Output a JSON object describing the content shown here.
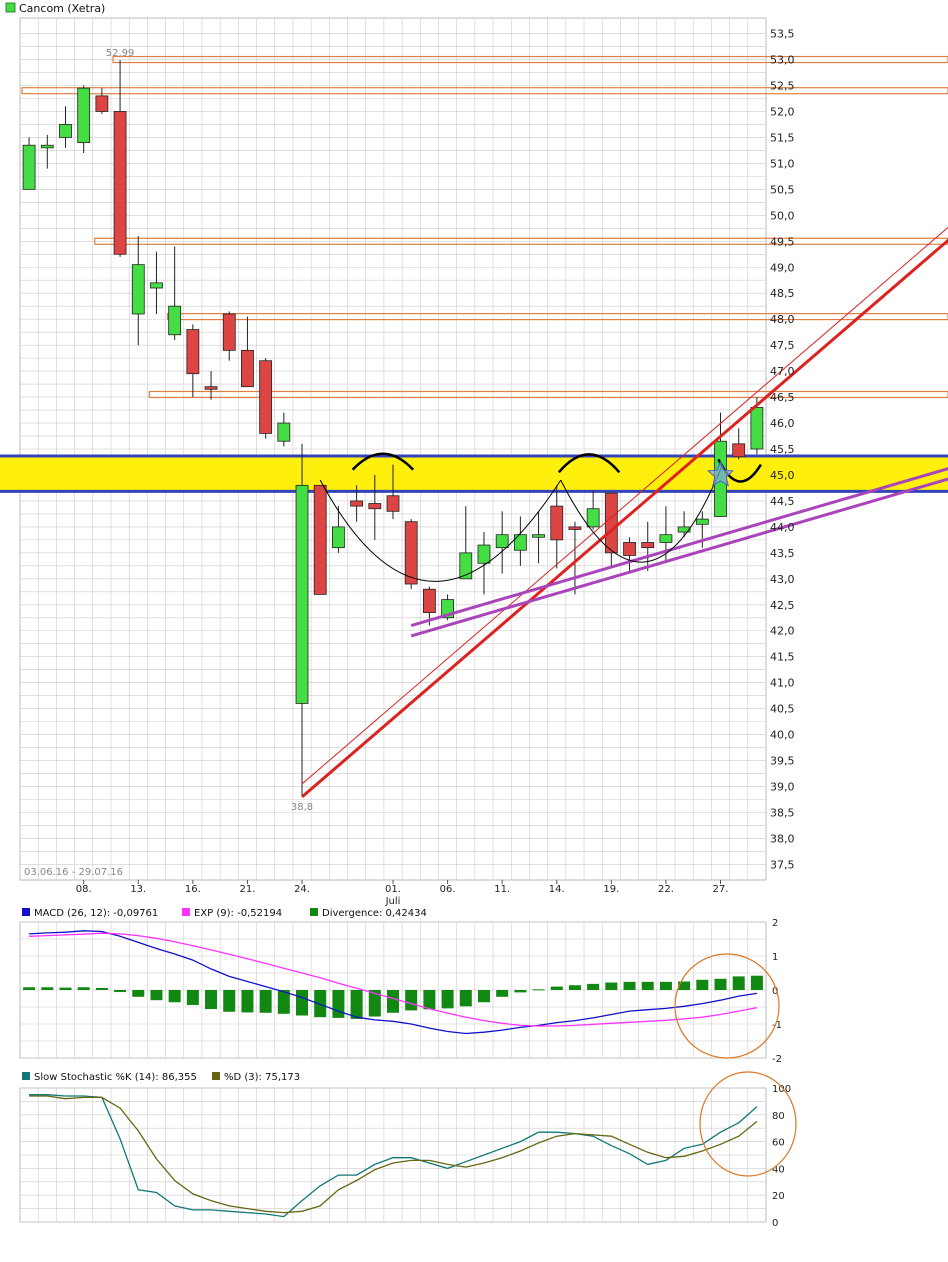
{
  "title": "Cancom (Xetra)",
  "date_range": "03.06.16 - 29.07.16",
  "colors": {
    "up": "#44dd44",
    "down": "#dd4444",
    "grid": "#cccccc",
    "support_band": "#ffee00",
    "support_band_border": "#3344bb",
    "resistance": "#e08040",
    "trend_red": "#dd2222",
    "trend_purple": "#aa44bb",
    "pattern": "#000000",
    "macd": "#1111cc",
    "exp": "#ff33ff",
    "divergence": "#118811",
    "stoch_k": "#117777",
    "stoch_d": "#666611",
    "highlight_circle": "#dd7722"
  },
  "chart_data": [
    {
      "type": "candlestick",
      "title": "Cancom (Xetra)",
      "ylim": [
        37.2,
        53.8
      ],
      "y_ticks": [
        "53,5",
        "53,0",
        "52,5",
        "52,0",
        "51,5",
        "51,0",
        "50,5",
        "50,0",
        "49,5",
        "49,0",
        "48,5",
        "48,0",
        "47,5",
        "47,0",
        "46,5",
        "46,0",
        "45,5",
        "45,0",
        "44,5",
        "44,0",
        "43,5",
        "43,0",
        "42,5",
        "42,0",
        "41,5",
        "41,0",
        "40,5",
        "40,0",
        "39,5",
        "39,0",
        "38,5",
        "38,0",
        "37,5"
      ],
      "x_labels": [
        {
          "i": 3,
          "label": "08."
        },
        {
          "i": 6,
          "label": "13."
        },
        {
          "i": 9,
          "label": "16."
        },
        {
          "i": 12,
          "label": "21."
        },
        {
          "i": 15,
          "label": "24."
        },
        {
          "i": 20,
          "label": "01."
        },
        {
          "i": 23,
          "label": "06."
        },
        {
          "i": 26,
          "label": "11."
        },
        {
          "i": 29,
          "label": "14."
        },
        {
          "i": 32,
          "label": "19."
        },
        {
          "i": 35,
          "label": "22."
        },
        {
          "i": 38,
          "label": "27."
        }
      ],
      "month_label": {
        "i": 20,
        "label": "Juli"
      },
      "annotations": [
        {
          "i": 5,
          "price": 52.99,
          "label": "52,99"
        },
        {
          "i": 15,
          "price": 38.8,
          "label": "38,8"
        }
      ],
      "candles": [
        {
          "date": "03.06.",
          "open": 50.5,
          "high": 51.5,
          "low": 50.5,
          "close": 51.35
        },
        {
          "date": "06.06.",
          "open": 51.3,
          "high": 51.55,
          "low": 50.9,
          "close": 51.35
        },
        {
          "date": "07.06.",
          "open": 51.5,
          "high": 52.1,
          "low": 51.3,
          "close": 51.75
        },
        {
          "date": "08.06.",
          "open": 51.4,
          "high": 52.5,
          "low": 51.2,
          "close": 52.45
        },
        {
          "date": "09.06.",
          "open": 52.3,
          "high": 52.45,
          "low": 51.95,
          "close": 52.0
        },
        {
          "date": "10.06.",
          "open": 52.0,
          "high": 52.99,
          "low": 49.2,
          "close": 49.25
        },
        {
          "date": "13.06.",
          "open": 48.1,
          "high": 49.6,
          "low": 47.5,
          "close": 49.05
        },
        {
          "date": "14.06.",
          "open": 48.6,
          "high": 49.3,
          "low": 48.1,
          "close": 48.7
        },
        {
          "date": "15.06.",
          "open": 47.7,
          "high": 49.4,
          "low": 47.6,
          "close": 48.25
        },
        {
          "date": "16.06.",
          "open": 47.8,
          "high": 47.9,
          "low": 46.5,
          "close": 46.95
        },
        {
          "date": "17.06.",
          "open": 46.7,
          "high": 47.0,
          "low": 46.45,
          "close": 46.65
        },
        {
          "date": "20.06.",
          "open": 48.1,
          "high": 48.15,
          "low": 47.2,
          "close": 47.4
        },
        {
          "date": "21.06.",
          "open": 47.4,
          "high": 48.05,
          "low": 46.7,
          "close": 46.7
        },
        {
          "date": "22.06.",
          "open": 47.2,
          "high": 47.25,
          "low": 45.7,
          "close": 45.8
        },
        {
          "date": "23.06.",
          "open": 45.65,
          "high": 46.2,
          "low": 45.55,
          "close": 46.0
        },
        {
          "date": "24.06.",
          "open": 40.6,
          "high": 45.6,
          "low": 38.8,
          "close": 44.8
        },
        {
          "date": "27.06.",
          "open": 44.8,
          "high": 44.8,
          "low": 42.7,
          "close": 42.7
        },
        {
          "date": "28.06.",
          "open": 43.6,
          "high": 44.4,
          "low": 43.5,
          "close": 44.0
        },
        {
          "date": "29.06.",
          "open": 44.5,
          "high": 44.8,
          "low": 44.1,
          "close": 44.4
        },
        {
          "date": "30.06.",
          "open": 44.45,
          "high": 45.0,
          "low": 43.75,
          "close": 44.35
        },
        {
          "date": "01.07.",
          "open": 44.6,
          "high": 45.2,
          "low": 44.15,
          "close": 44.3
        },
        {
          "date": "04.07.",
          "open": 44.1,
          "high": 44.15,
          "low": 42.8,
          "close": 42.9
        },
        {
          "date": "05.07.",
          "open": 42.8,
          "high": 42.85,
          "low": 42.1,
          "close": 42.35
        },
        {
          "date": "06.07.",
          "open": 42.25,
          "high": 42.7,
          "low": 42.2,
          "close": 42.6
        },
        {
          "date": "07.07.",
          "open": 43.0,
          "high": 44.4,
          "low": 43.0,
          "close": 43.5
        },
        {
          "date": "08.07.",
          "open": 43.3,
          "high": 43.9,
          "low": 42.7,
          "close": 43.65
        },
        {
          "date": "11.07.",
          "open": 43.6,
          "high": 44.3,
          "low": 43.1,
          "close": 43.85
        },
        {
          "date": "12.07.",
          "open": 43.55,
          "high": 44.2,
          "low": 43.25,
          "close": 43.85
        },
        {
          "date": "13.07.",
          "open": 43.8,
          "high": 44.3,
          "low": 43.3,
          "close": 43.85
        },
        {
          "date": "14.07.",
          "open": 44.4,
          "high": 44.8,
          "low": 43.2,
          "close": 43.75
        },
        {
          "date": "15.07.",
          "open": 44.0,
          "high": 44.1,
          "low": 42.7,
          "close": 43.95
        },
        {
          "date": "18.07.",
          "open": 44.0,
          "high": 44.7,
          "low": 43.95,
          "close": 44.35
        },
        {
          "date": "19.07.",
          "open": 44.65,
          "high": 44.65,
          "low": 43.2,
          "close": 43.5
        },
        {
          "date": "20.07.",
          "open": 43.7,
          "high": 43.8,
          "low": 43.1,
          "close": 43.45
        },
        {
          "date": "21.07.",
          "open": 43.7,
          "high": 44.1,
          "low": 43.15,
          "close": 43.6
        },
        {
          "date": "22.07.",
          "open": 43.7,
          "high": 44.4,
          "low": 43.3,
          "close": 43.85
        },
        {
          "date": "25.07.",
          "open": 43.9,
          "high": 44.3,
          "low": 43.8,
          "close": 44.0
        },
        {
          "date": "26.07.",
          "open": 44.05,
          "high": 44.3,
          "low": 43.6,
          "close": 44.15
        },
        {
          "date": "27.07.",
          "open": 44.2,
          "high": 46.2,
          "low": 44.2,
          "close": 45.65
        },
        {
          "date": "28.07.",
          "open": 45.6,
          "high": 45.9,
          "low": 45.3,
          "close": 45.35
        },
        {
          "date": "29.07.",
          "open": 45.5,
          "high": 46.5,
          "low": 45.4,
          "close": 46.3
        }
      ],
      "horizontal_levels": [
        {
          "price": 53.0,
          "from_i": 5
        },
        {
          "price": 52.4,
          "from_i": 0
        },
        {
          "price": 49.5,
          "from_i": 4
        },
        {
          "price": 48.05,
          "from_i": 8
        },
        {
          "price": 46.55,
          "from_i": 7
        }
      ],
      "support_band": {
        "low": 44.8,
        "high": 45.25
      },
      "trend_lines": [
        {
          "kind": "red",
          "points": [
            [
              15,
              38.8
            ],
            [
              42,
              46.95
            ]
          ]
        },
        {
          "kind": "red_thin",
          "points": [
            [
              15,
              39.05
            ],
            [
              42,
              47.2
            ]
          ]
        },
        {
          "kind": "purple",
          "points": [
            [
              21,
              42.1
            ],
            [
              42,
              44.25
            ]
          ]
        },
        {
          "kind": "purple",
          "points": [
            [
              21,
              41.9
            ],
            [
              42,
              44.05
            ]
          ]
        }
      ]
    },
    {
      "type": "line",
      "title": "MACD",
      "ylim": [
        -2,
        2
      ],
      "y_ticks": [
        "2",
        "1",
        "0",
        "-1",
        "-2"
      ],
      "series": [
        {
          "name": "MACD (26, 12): -0,09761",
          "values": [
            1.65,
            1.68,
            1.7,
            1.74,
            1.72,
            1.58,
            1.4,
            1.22,
            1.06,
            0.88,
            0.62,
            0.4,
            0.25,
            0.1,
            -0.05,
            -0.22,
            -0.42,
            -0.62,
            -0.8,
            -0.88,
            -0.92,
            -1.0,
            -1.12,
            -1.22,
            -1.28,
            -1.24,
            -1.18,
            -1.1,
            -1.04,
            -0.96,
            -0.9,
            -0.82,
            -0.72,
            -0.62,
            -0.58,
            -0.54,
            -0.48,
            -0.4,
            -0.3,
            -0.18,
            -0.1
          ]
        },
        {
          "name": "EXP (9): -0,52194",
          "values": [
            1.58,
            1.6,
            1.62,
            1.64,
            1.67,
            1.65,
            1.6,
            1.52,
            1.42,
            1.3,
            1.18,
            1.05,
            0.92,
            0.78,
            0.64,
            0.5,
            0.36,
            0.2,
            0.05,
            -0.1,
            -0.25,
            -0.4,
            -0.55,
            -0.68,
            -0.8,
            -0.9,
            -0.98,
            -1.04,
            -1.06,
            -1.06,
            -1.04,
            -1.01,
            -0.98,
            -0.95,
            -0.92,
            -0.89,
            -0.85,
            -0.8,
            -0.72,
            -0.62,
            -0.52
          ]
        },
        {
          "name": "Divergence: 0,42434",
          "values": [
            0.08,
            0.08,
            0.07,
            0.08,
            0.06,
            -0.06,
            -0.2,
            -0.3,
            -0.36,
            -0.44,
            -0.56,
            -0.64,
            -0.66,
            -0.67,
            -0.7,
            -0.75,
            -0.8,
            -0.82,
            -0.85,
            -0.78,
            -0.67,
            -0.6,
            -0.57,
            -0.54,
            -0.48,
            -0.36,
            -0.2,
            -0.07,
            0.02,
            0.1,
            0.14,
            0.18,
            0.22,
            0.24,
            0.24,
            0.24,
            0.25,
            0.3,
            0.33,
            0.4,
            0.42
          ]
        }
      ]
    },
    {
      "type": "line",
      "title": "Slow Stochastic",
      "ylim": [
        0,
        100
      ],
      "y_ticks": [
        "100",
        "80",
        "60",
        "40",
        "20",
        "0"
      ],
      "series": [
        {
          "name": "Slow Stochastic %K (14): 86,355",
          "values": [
            95,
            95,
            94,
            94,
            93,
            62,
            24,
            22,
            12,
            9,
            9,
            8,
            7,
            6,
            4,
            16,
            27,
            35,
            35,
            43,
            48,
            48,
            44,
            40,
            45,
            50,
            55,
            60,
            67,
            67,
            66,
            64,
            57,
            51,
            43,
            46,
            55,
            58,
            67,
            74,
            86
          ]
        },
        {
          "name": "%D (3): 75,173",
          "values": [
            94,
            94,
            92,
            93,
            93,
            85,
            68,
            47,
            31,
            21,
            16,
            12,
            10,
            8,
            7,
            8,
            12,
            24,
            31,
            39,
            44,
            46,
            46,
            43,
            41,
            44,
            48,
            53,
            59,
            64,
            66,
            65,
            64,
            58,
            52,
            48,
            49,
            53,
            58,
            64,
            75
          ]
        }
      ]
    }
  ]
}
